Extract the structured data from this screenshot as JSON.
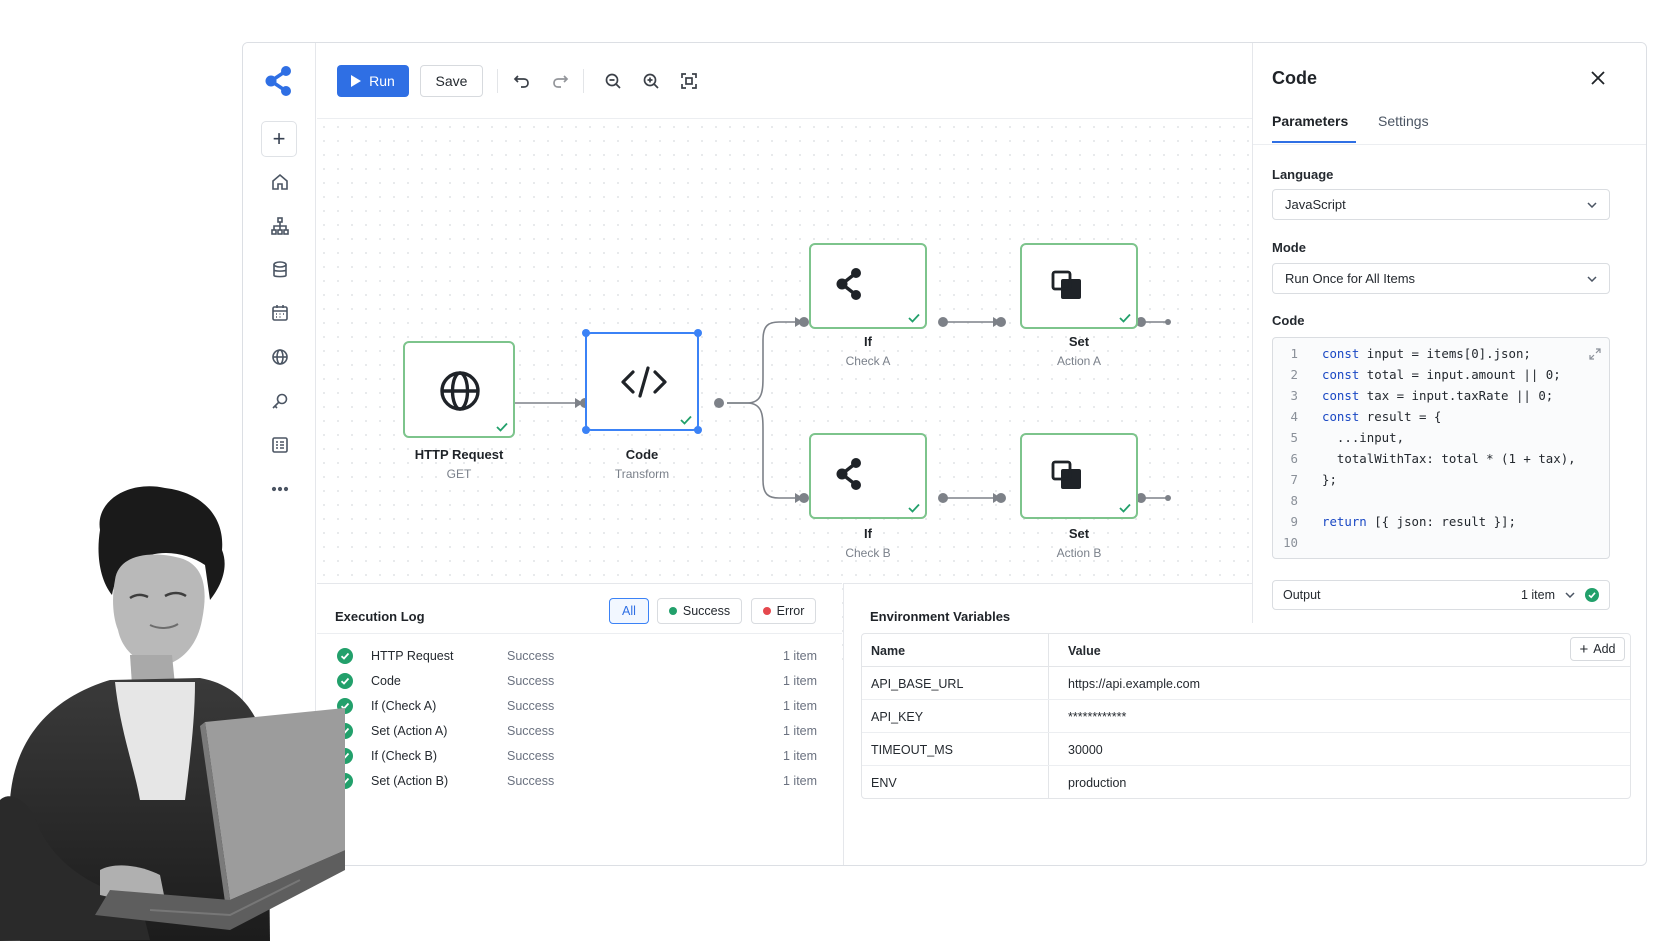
{
  "toolbar": {
    "run_label": "Run",
    "save_label": "Save"
  },
  "nodes": [
    {
      "id": "http",
      "title": "HTTP Request",
      "subtitle": "GET"
    },
    {
      "id": "code",
      "title": "Code",
      "subtitle": "Transform"
    },
    {
      "id": "ifa",
      "title": "If",
      "subtitle": "Check A"
    },
    {
      "id": "seta",
      "title": "Set",
      "subtitle": "Action A"
    },
    {
      "id": "ifb",
      "title": "If",
      "subtitle": "Check B"
    },
    {
      "id": "setb",
      "title": "Set",
      "subtitle": "Action B"
    }
  ],
  "panel": {
    "title": "Code",
    "tabs": [
      "Parameters",
      "Settings"
    ],
    "language_label": "Language",
    "language_value": "JavaScript",
    "mode_label": "Mode",
    "mode_value": "Run Once for All Items",
    "code_label": "Code",
    "code_lines": [
      {
        "n": "1",
        "kw": "const",
        "rest": " input = items[0].json;"
      },
      {
        "n": "2",
        "kw": "const",
        "rest": " total = input.amount || 0;"
      },
      {
        "n": "3",
        "kw": "const",
        "rest": " tax = input.taxRate || 0;"
      },
      {
        "n": "4",
        "kw": "const",
        "rest": " result = {"
      },
      {
        "n": "5",
        "kw": "",
        "rest": "  ...input,"
      },
      {
        "n": "6",
        "kw": "",
        "rest": "  totalWithTax: total * (1 + tax),"
      },
      {
        "n": "7",
        "kw": "",
        "rest": "};"
      },
      {
        "n": "8",
        "kw": "",
        "rest": ""
      },
      {
        "n": "9",
        "kw": "return",
        "rest": " [{ json: result }];"
      },
      {
        "n": "10",
        "kw": "",
        "rest": ""
      }
    ],
    "output_label": "Output",
    "output_count": "1 item"
  },
  "log": {
    "title": "Execution Log",
    "filters": [
      "All",
      "Success",
      "Error"
    ],
    "rows": [
      {
        "name": "HTTP Request",
        "status": "Success",
        "count": "1 item"
      },
      {
        "name": "Code",
        "status": "Success",
        "count": "1 item"
      },
      {
        "name": "If (Check A)",
        "status": "Success",
        "count": "1 item"
      },
      {
        "name": "Set (Action A)",
        "status": "Success",
        "count": "1 item"
      },
      {
        "name": "If (Check B)",
        "status": "Success",
        "count": "1 item"
      },
      {
        "name": "Set (Action B)",
        "status": "Success",
        "count": "1 item"
      }
    ]
  },
  "env": {
    "title": "Environment Variables",
    "col_name": "Name",
    "col_value": "Value",
    "add_label": "Add",
    "rows": [
      {
        "name": "API_BASE_URL",
        "value": "https://api.example.com"
      },
      {
        "name": "API_KEY",
        "value": "************"
      },
      {
        "name": "TIMEOUT_MS",
        "value": "30000"
      },
      {
        "name": "ENV",
        "value": "production"
      }
    ]
  },
  "colors": {
    "accent": "#2f6fe4",
    "success": "#22a06b",
    "error": "#e5484d",
    "node_border": "#7dc48c"
  }
}
